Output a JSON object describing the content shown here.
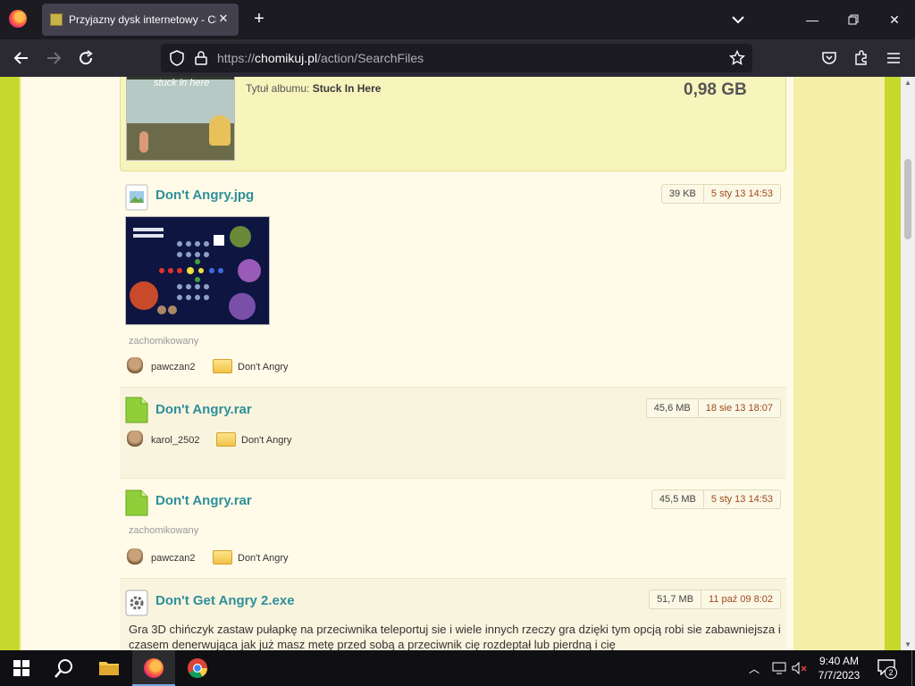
{
  "browser": {
    "tab_title": "Przyjazny dysk internetowy - Ch",
    "url_scheme": "https://",
    "url_domain": "chomikuj.pl",
    "url_path": "/action/SearchFiles"
  },
  "album": {
    "cover_text": "stuck in here",
    "label_prefix": "Tytuł albumu:",
    "label_value": "Stuck In Here",
    "size": "0,98 GB"
  },
  "files": [
    {
      "name": "Don't Angry.jpg",
      "size": "39 KB",
      "date": "5 sty 13 14:53",
      "status": "zachomikowany",
      "owner": "pawczan2",
      "folder": "Don't Angry",
      "icon": "image-file-icon"
    },
    {
      "name": "Don't Angry.rar",
      "size": "45,6 MB",
      "date": "18 sie 13 18:07",
      "owner": "karol_2502",
      "folder": "Don't Angry",
      "icon": "archive-file-icon"
    },
    {
      "name": "Don't Angry.rar",
      "size": "45,5 MB",
      "date": "5 sty 13 14:53",
      "status": "zachomikowany",
      "owner": "pawczan2",
      "folder": "Don't Angry",
      "icon": "archive-file-icon"
    },
    {
      "name": "Don't Get Angry 2.exe",
      "size": "51,7 MB",
      "date": "11 paź 09 8:02",
      "icon": "gear-file-icon",
      "description": "Gra 3D chińczyk zastaw pułapkę na przeciwnika teleportuj sie i wiele innych rzeczy gra dzięki tym opcją robi sie zabawniejsza i czasem denerwująca jak już masz metę przed sobą a przeciwnik cię rozdeptał lub pierdną i cię"
    }
  ],
  "taskbar": {
    "time": "9:40 AM",
    "date": "7/7/2023",
    "notification_count": "2"
  },
  "colors": {
    "link": "#2f8f9a",
    "accent_green": "#6ca322",
    "page_border": "#c6d92c",
    "date_text": "#a0491f"
  }
}
